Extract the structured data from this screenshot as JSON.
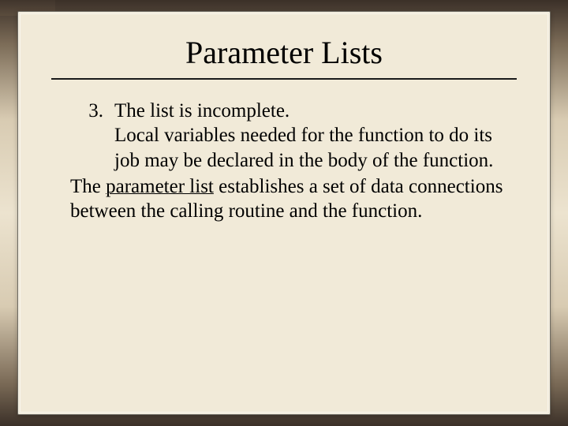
{
  "title": "Parameter Lists",
  "list": {
    "number": "3.",
    "lead": "The list is incomplete.",
    "rest": "Local variables needed for the function to do its job may be declared in the body of the function."
  },
  "paragraph": {
    "pre": "The ",
    "underlined": "parameter list",
    "post": " establishes a set of data connections between the calling routine and the function."
  }
}
